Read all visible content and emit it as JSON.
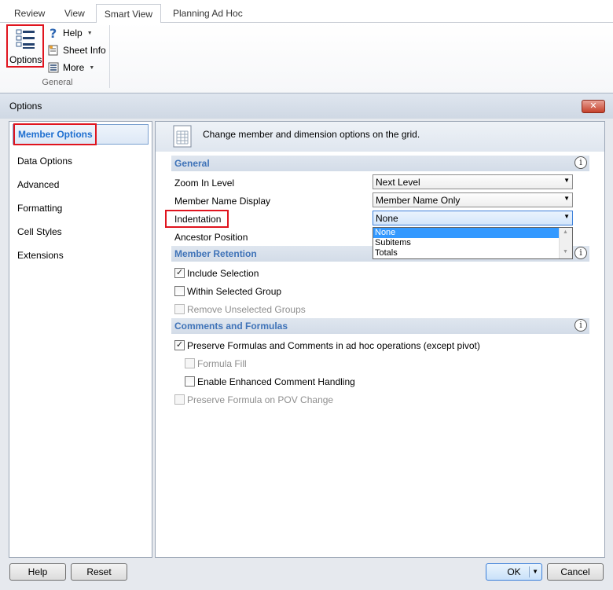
{
  "ribbon": {
    "tabs": [
      "Review",
      "View",
      "Smart View",
      "Planning Ad Hoc"
    ],
    "active_tab": "Smart View",
    "options_label": "Options",
    "help_label": "Help",
    "sheet_info_label": "Sheet Info",
    "more_label": "More",
    "group_label": "General"
  },
  "dialog": {
    "title": "Options",
    "close_glyph": "✕",
    "nav": {
      "selected": "Member Options",
      "items": [
        "Data Options",
        "Advanced",
        "Formatting",
        "Cell Styles",
        "Extensions"
      ]
    },
    "header_text": "Change member and dimension options on the grid.",
    "sections": {
      "general": "General",
      "member_retention": "Member Retention",
      "comments": "Comments and Formulas"
    },
    "general": {
      "zoom_label": "Zoom In Level",
      "zoom_value": "Next Level",
      "name_display_label": "Member Name Display",
      "name_display_value": "Member Name Only",
      "indentation_label": "Indentation",
      "indentation_value": "None",
      "indentation_options": [
        "None",
        "Subitems",
        "Totals"
      ],
      "ancestor_label": "Ancestor Position"
    },
    "retention": {
      "include_selection": {
        "label": "Include Selection",
        "checked": true,
        "enabled": true
      },
      "within_group": {
        "label": "Within Selected Group",
        "checked": false,
        "enabled": true
      },
      "remove_unselected": {
        "label": "Remove Unselected Groups",
        "checked": false,
        "enabled": false
      }
    },
    "comments": {
      "preserve_formulas": {
        "label": "Preserve Formulas and Comments in ad hoc operations (except pivot)",
        "checked": true,
        "enabled": true
      },
      "formula_fill": {
        "label": "Formula Fill",
        "checked": false,
        "enabled": false
      },
      "enhanced_comment": {
        "label": "Enable Enhanced Comment Handling",
        "checked": false,
        "enabled": true
      },
      "preserve_pov": {
        "label": "Preserve Formula on POV Change",
        "checked": false,
        "enabled": false
      }
    },
    "buttons": {
      "help": "Help",
      "reset": "Reset",
      "ok": "OK",
      "cancel": "Cancel"
    }
  },
  "colors": {
    "highlight_box": "#e0141e",
    "section_title": "#3f73b8",
    "selection": "#3399ff"
  },
  "icons": [
    "options-list-icon",
    "help-question-icon",
    "sheet-info-icon",
    "more-icon",
    "grid-document-icon",
    "info-icon",
    "close-icon"
  ]
}
